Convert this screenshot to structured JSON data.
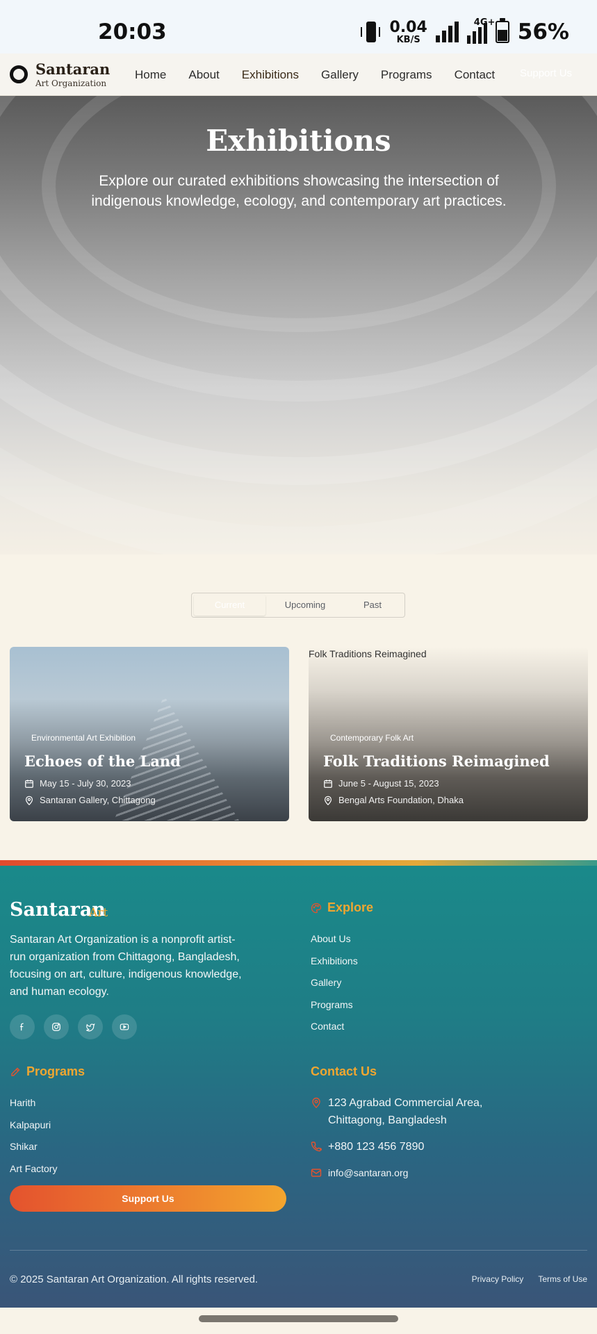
{
  "status_bar": {
    "time": "20:03",
    "speed_value": "0.04",
    "speed_unit": "KB/S",
    "network": "4G+",
    "battery_percent": "56%",
    "battery_level": 0.56
  },
  "nav": {
    "logo_name": "Santaran",
    "logo_sub": "Art Organization",
    "links": [
      "Home",
      "About",
      "Exhibitions",
      "Gallery",
      "Programs",
      "Contact"
    ],
    "active": "Exhibitions",
    "support_label": "Support Us"
  },
  "hero": {
    "title": "Exhibitions",
    "subtitle": "Explore our curated exhibitions showcasing the intersection of indigenous knowledge, ecology, and contemporary art practices."
  },
  "tabs": {
    "items": [
      "Current",
      "Upcoming",
      "Past"
    ],
    "selected": "Current"
  },
  "exhibitions": [
    {
      "tag": "Environmental Art Exhibition",
      "title": "Echoes of the Land",
      "dates": "May 15 - July 30, 2023",
      "location": "Santaran Gallery, Chittagong",
      "image_alt": ""
    },
    {
      "tag": "Contemporary Folk Art",
      "title": "Folk Traditions Reimagined",
      "dates": "June 5 - August 15, 2023",
      "location": "Bengal Arts Foundation, Dhaka",
      "image_alt": "Folk Traditions Reimagined"
    }
  ],
  "footer": {
    "brand": "Santaran",
    "brand_accent": "Art",
    "description": "Santaran Art Organization is a nonprofit artist-run organization from Chittagong, Bangladesh, focusing on art, culture, indigenous knowledge, and human ecology.",
    "social_icons": [
      "facebook-icon",
      "instagram-icon",
      "twitter-icon",
      "youtube-icon"
    ],
    "explore_heading": "Explore",
    "explore_links": [
      "About Us",
      "Exhibitions",
      "Gallery",
      "Programs",
      "Contact"
    ],
    "programs_heading": "Programs",
    "programs_links": [
      "Harith",
      "Kalpapuri",
      "Shikar",
      "Art Factory"
    ],
    "support_label": "Support Us",
    "contact_heading": "Contact Us",
    "address": "123 Agrabad Commercial Area, Chittagong, Bangladesh",
    "phone": "+880 123 456 7890",
    "email": "info@santaran.org",
    "copyright": "© 2025 Santaran Art Organization. All rights reserved.",
    "legal_links": [
      "Privacy Policy",
      "Terms of Use"
    ]
  },
  "colors": {
    "accent": "#f0a630",
    "footer_teal": "#1a8a8a",
    "page_bg": "#f8f3e8",
    "support_gradient_start": "#e4532e",
    "support_gradient_end": "#f3a52e"
  }
}
